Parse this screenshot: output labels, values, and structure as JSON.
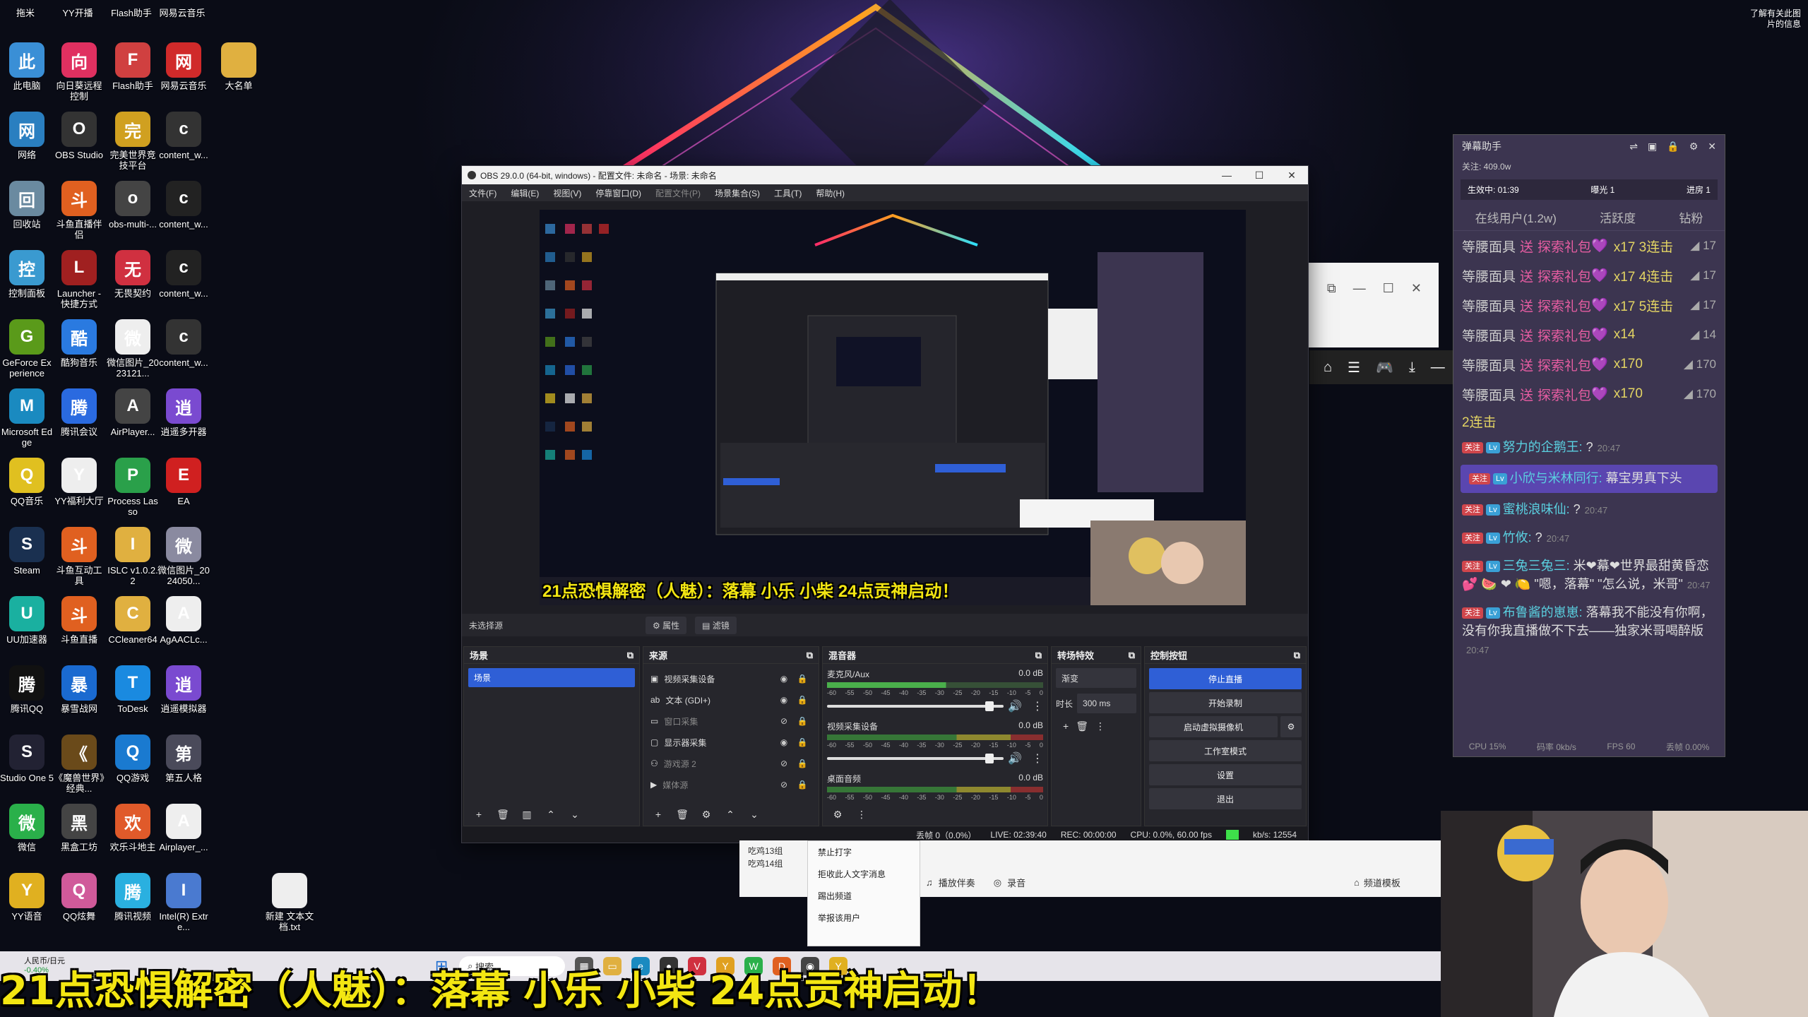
{
  "desktop": {
    "top_labels": [
      "拖米",
      "YY开播",
      "Flash助手",
      "网易云音乐"
    ],
    "columns": [
      [
        {
          "label": "此电脑",
          "icon": "computer-icon",
          "color": "#3a8fd6"
        },
        {
          "label": "网络",
          "icon": "network-icon",
          "color": "#2a7fc0"
        },
        {
          "label": "回收站",
          "icon": "recycle-bin-icon",
          "color": "#6a8aa0"
        },
        {
          "label": "控制面板",
          "icon": "control-panel-icon",
          "color": "#3a9ad0"
        },
        {
          "label": "GeForce Experience",
          "icon": "geforce-icon",
          "color": "#5a9a1a"
        },
        {
          "label": "Microsoft Edge",
          "icon": "edge-icon",
          "color": "#1a8ac0"
        },
        {
          "label": "QQ音乐",
          "icon": "qq-music-icon",
          "color": "#e0c020"
        },
        {
          "label": "Steam",
          "icon": "steam-icon",
          "color": "#1a3050"
        },
        {
          "label": "UU加速器",
          "icon": "uu-icon",
          "color": "#1ab0a0"
        },
        {
          "label": "腾讯QQ",
          "icon": "qq-icon",
          "color": "#111"
        },
        {
          "label": "Studio One 5",
          "icon": "studio-one-icon",
          "color": "#223"
        },
        {
          "label": "微信",
          "icon": "wechat-icon",
          "color": "#2ab04a"
        },
        {
          "label": "YY语音",
          "icon": "yy-icon",
          "color": "#e0b020"
        }
      ],
      [
        {
          "label": "向日葵远程控制",
          "icon": "sunflower-icon",
          "color": "#e03060"
        },
        {
          "label": "OBS Studio",
          "icon": "obs-icon",
          "color": "#333"
        },
        {
          "label": "斗鱼直播伴侣",
          "icon": "douyu-icon",
          "color": "#e06020"
        },
        {
          "label": "Launcher - 快捷方式",
          "icon": "launcher-icon",
          "color": "#a02020"
        },
        {
          "label": "酷狗音乐",
          "icon": "kugou-icon",
          "color": "#2a7ae0"
        },
        {
          "label": "腾讯会议",
          "icon": "tencent-meeting-icon",
          "color": "#2a6ae0"
        },
        {
          "label": "YY福利大厅",
          "icon": "file-icon",
          "color": "#eee"
        },
        {
          "label": "斗鱼互动工具",
          "icon": "douyu-tool-icon",
          "color": "#e06020"
        },
        {
          "label": "斗鱼直播",
          "icon": "douyu-live-icon",
          "color": "#e06020"
        },
        {
          "label": "暴雪战网",
          "icon": "battlenet-icon",
          "color": "#1a6ad0"
        },
        {
          "label": "《魔兽世界》经典...",
          "icon": "wow-icon",
          "color": "#6a4a1a"
        },
        {
          "label": "黑盒工坊",
          "icon": "heihe-icon",
          "color": "#444"
        },
        {
          "label": "QQ炫舞",
          "icon": "qq-dance-icon",
          "color": "#d05a9a"
        }
      ],
      [
        {
          "label": "Flash助手",
          "icon": "flash-icon",
          "color": "#d04040"
        },
        {
          "label": "完美世界竞技平台",
          "icon": "perfect-world-icon",
          "color": "#d0a020"
        },
        {
          "label": "obs-multi-...",
          "icon": "obs-multi-icon",
          "color": "#444"
        },
        {
          "label": "无畏契约",
          "icon": "valorant-icon",
          "color": "#d03040"
        },
        {
          "label": "微信图片_2023121...",
          "icon": "image-icon",
          "color": "#eee"
        },
        {
          "label": "AirPlayer...",
          "icon": "airplayer-icon",
          "color": "#444"
        },
        {
          "label": "Process Lasso",
          "icon": "process-lasso-icon",
          "color": "#2aa04a"
        },
        {
          "label": "ISLC v1.0.2.2",
          "icon": "folder-icon",
          "color": "#e0b040"
        },
        {
          "label": "CCleaner64",
          "icon": "folder-icon",
          "color": "#e0b040"
        },
        {
          "label": "ToDesk",
          "icon": "todesk-icon",
          "color": "#1a8ae0"
        },
        {
          "label": "QQ游戏",
          "icon": "qq-game-icon",
          "color": "#1a7ad0"
        },
        {
          "label": "欢乐斗地主",
          "icon": "doudizhu-icon",
          "color": "#e05a2a"
        },
        {
          "label": "腾讯视频",
          "icon": "tencent-video-icon",
          "color": "#2ab0e0"
        }
      ],
      [
        {
          "label": "网易云音乐",
          "icon": "netease-icon",
          "color": "#d02a2a"
        },
        {
          "label": "content_w...",
          "icon": "image-icon",
          "color": "#333"
        },
        {
          "label": "content_w...",
          "icon": "image-icon",
          "color": "#222"
        },
        {
          "label": "content_w...",
          "icon": "image-icon",
          "color": "#222"
        },
        {
          "label": "content_w...",
          "icon": "image-icon",
          "color": "#333"
        },
        {
          "label": "逍遥多开器",
          "icon": "xiaoyao-multi-icon",
          "color": "#7a4ad0"
        },
        {
          "label": "EA",
          "icon": "ea-icon",
          "color": "#d02020"
        },
        {
          "label": "微信图片_2024050...",
          "icon": "image-icon",
          "color": "#8a8aa0"
        },
        {
          "label": "AgAACLc...",
          "icon": "image-icon",
          "color": "#eee"
        },
        {
          "label": "逍遥模拟器",
          "icon": "xiaoyao-icon",
          "color": "#7a4ad0"
        },
        {
          "label": "第五人格",
          "icon": "identity-v-icon",
          "color": "#4a4a5a"
        },
        {
          "label": "Airplayer_...",
          "icon": "file-icon",
          "color": "#eee"
        },
        {
          "label": "Intel(R) Extre...",
          "icon": "intel-icon",
          "color": "#4a7ad0"
        }
      ]
    ],
    "extra": [
      {
        "label": "大名单",
        "icon": "folder-icon",
        "color": "#e0b040"
      },
      {
        "label": "新建 文本文档.txt",
        "icon": "text-file-icon",
        "color": "#eee"
      }
    ],
    "corner_note": "了解有关此图片的信息"
  },
  "obs": {
    "title": "OBS 29.0.0 (64-bit, windows) - 配置文件: 未命名 - 场景: 未命名",
    "menu": [
      "文件(F)",
      "编辑(E)",
      "视图(V)",
      "停靠窗口(D)",
      "配置文件(P)",
      "场景集合(S)",
      "工具(T)",
      "帮助(H)"
    ],
    "no_source": "未选择源",
    "properties_label": "属性",
    "filters_label": "滤镜",
    "preview_banner": "21点恐惧解密（人魅）：落幕 小乐 小柴 24点贡神启动！",
    "scenes": {
      "title": "场景",
      "items": [
        "场景"
      ]
    },
    "sources": {
      "title": "来源",
      "items": [
        {
          "name": "视频采集设备",
          "icon": "camera-icon",
          "visible": true
        },
        {
          "name": "文本 (GDI+)",
          "icon": "text-icon",
          "visible": true
        },
        {
          "name": "窗口采集",
          "icon": "window-icon",
          "visible": false
        },
        {
          "name": "显示器采集",
          "icon": "monitor-icon",
          "visible": true
        },
        {
          "name": "游戏源 2",
          "icon": "gamepad-icon",
          "visible": false
        },
        {
          "name": "媒体源",
          "icon": "play-icon",
          "visible": false
        }
      ]
    },
    "mixer": {
      "title": "混音器",
      "ticks": [
        "-60",
        "-55",
        "-50",
        "-45",
        "-40",
        "-35",
        "-30",
        "-25",
        "-20",
        "-15",
        "-10",
        "-5",
        "0"
      ],
      "channels": [
        {
          "name": "麦克风/Aux",
          "db": "0.0 dB"
        },
        {
          "name": "视频采集设备",
          "db": "0.0 dB"
        },
        {
          "name": "桌面音频",
          "db": "0.0 dB"
        }
      ]
    },
    "transitions": {
      "title": "转场特效",
      "type": "渐变",
      "duration_label": "时长",
      "duration": "300 ms"
    },
    "controls": {
      "title": "控制按钮",
      "buttons": [
        "停止直播",
        "开始录制",
        "启动虚拟摄像机",
        "工作室模式",
        "设置",
        "退出"
      ]
    },
    "status": {
      "dropped": "丢帧 0（0.0%）",
      "live": "LIVE: 02:39:40",
      "rec": "REC: 00:00:00",
      "cpu": "CPU: 0.0%, 60.00 fps",
      "kbps": "kb/s: 12554"
    }
  },
  "danmu": {
    "title": "弹幕助手",
    "follow": "关注: 409.0w",
    "stat_time": "生效中: 01:39",
    "stat_exposure": "曝光 1",
    "stat_rank": "进房 1",
    "tabs": [
      "在线用户(1.2w)",
      "活跃度",
      "钻粉"
    ],
    "gifts": [
      {
        "user": "等腰面具",
        "action": "送",
        "gift": "探索礼包",
        "count": "x17 3连击",
        "n": "17"
      },
      {
        "user": "等腰面具",
        "action": "送",
        "gift": "探索礼包",
        "count": "x17 4连击",
        "n": "17"
      },
      {
        "user": "等腰面具",
        "action": "送",
        "gift": "探索礼包",
        "count": "x17 5连击",
        "n": "17"
      },
      {
        "user": "等腰面具",
        "action": "送",
        "gift": "探索礼包",
        "count": "x14",
        "n": "14"
      },
      {
        "user": "等腰面具",
        "action": "送",
        "gift": "探索礼包",
        "count": "x170",
        "n": "170"
      },
      {
        "user": "等腰面具",
        "action": "送",
        "gift": "探索礼包",
        "count": "x170",
        "n": "170"
      }
    ],
    "combo": "2连击",
    "messages": [
      {
        "name": "努力的企鹅王:",
        "text": "?",
        "time": "20:47",
        "hl": false
      },
      {
        "name": "小欣与米林同行:",
        "text": "幕宝男真下头",
        "time": "",
        "hl": true
      },
      {
        "name": "蜜桃浪味仙:",
        "text": "?",
        "time": "20:47",
        "hl": false
      },
      {
        "name": "竹攸:",
        "text": "?",
        "time": "20:47",
        "hl": false
      },
      {
        "name": "三兔三兔三:",
        "text": "米❤幕❤世界最甜黄昏恋💕 🍉 ❤ 🍋 \"嗯，落幕\" \"怎么说，米哥\"",
        "time": "20:47",
        "hl": false
      },
      {
        "name": "布鲁酱的崽崽:",
        "text": "落幕我不能没有你啊，没有你我直播做不下去——独家米哥喝醉版",
        "time": "20:47",
        "hl": false
      }
    ],
    "footer": [
      "CPU 15%",
      "码率 0kb/s",
      "FPS 60",
      "丢帧 0.00%"
    ]
  },
  "yy": {
    "groups": [
      "吃鸡13组",
      "吃鸡14组"
    ],
    "menu": [
      "禁止打字",
      "拒收此人文字消息",
      "踢出频道",
      "举报该用户"
    ],
    "bottom": [
      "播放伴奏",
      "录音",
      "频道模板"
    ]
  },
  "taskbar": {
    "stock_name": "人民币/日元",
    "stock_change": "-0.40%",
    "search": "搜索"
  },
  "banner": "21点恐惧解密（人魅）：落幕 小乐 小柴 24点贡神启动！"
}
